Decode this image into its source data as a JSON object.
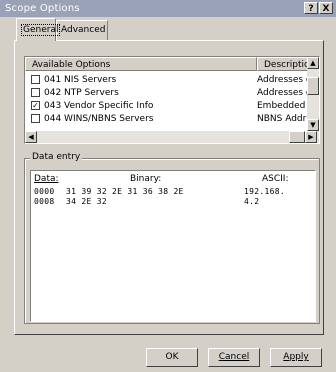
{
  "window": {
    "title": "Scope Options",
    "help_glyph": "?",
    "close_glyph": "X"
  },
  "tabs": [
    {
      "label": "General"
    },
    {
      "label": "Advanced"
    }
  ],
  "options_list": {
    "columns": [
      "Available Options",
      "Description"
    ],
    "rows": [
      {
        "checked": false,
        "name": "041 NIS Servers",
        "desc": "Addresses c"
      },
      {
        "checked": false,
        "name": "042 NTP Servers",
        "desc": "Addresses c"
      },
      {
        "checked": true,
        "name": "043 Vendor Specific Info",
        "desc": "Embedded v"
      },
      {
        "checked": false,
        "name": "044 WINS/NBNS Servers",
        "desc": "NBNS Addr"
      }
    ]
  },
  "data_entry": {
    "group_label": "Data entry",
    "headers": {
      "data": "Data:",
      "binary": "Binary:",
      "ascii": "ASCII:"
    },
    "rows": [
      {
        "offset": "0000",
        "bytes": "31 39 32 2E 31 36 38 2E",
        "ascii": "192.168."
      },
      {
        "offset": "0008",
        "bytes": "34 2E 32",
        "ascii": "4.2"
      }
    ]
  },
  "buttons": {
    "ok": "OK",
    "cancel": "Cancel",
    "apply": "Apply"
  }
}
